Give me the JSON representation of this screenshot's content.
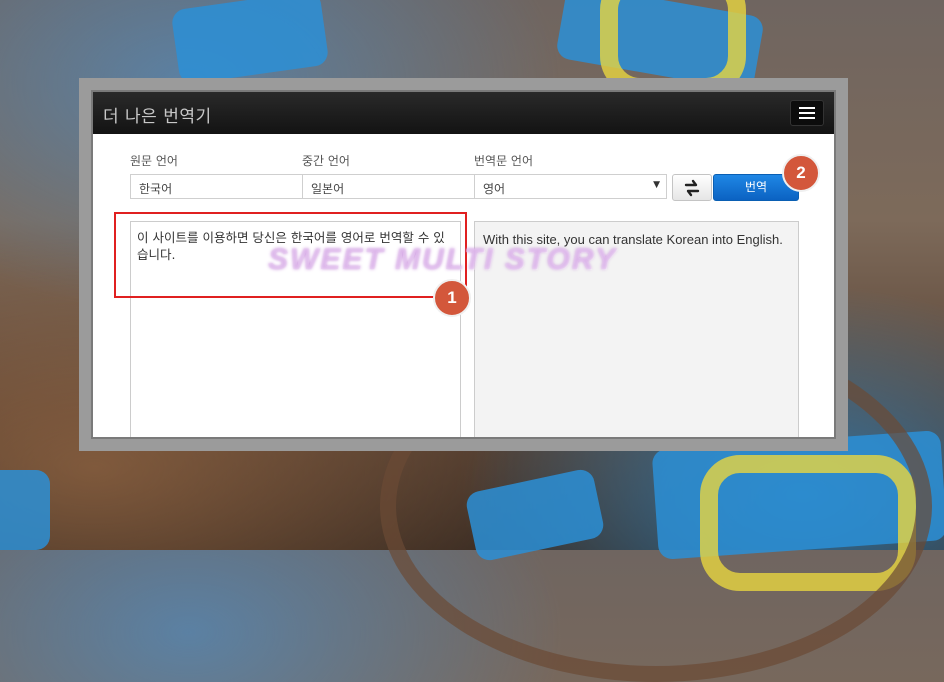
{
  "app": {
    "title": "더 나은 번역기"
  },
  "labels": {
    "source_language": "원문 언어",
    "middle_language": "중간 언어",
    "target_language": "번역문 언어"
  },
  "fields": {
    "source_language_value": "한국어",
    "middle_language_value": "일본어",
    "target_language_value": "영어"
  },
  "buttons": {
    "translate": "번역"
  },
  "icons": {
    "menu": "hamburger-menu-icon",
    "swap": "swap-arrows-icon",
    "dropdown": "chevron-down-icon"
  },
  "source_text": "이 사이트를 이용하면 당신은 한국어를 영어로 번역할 수 있습니다.",
  "output_text": "With this site, you can translate Korean into English.",
  "annotations": {
    "badge_1": "1",
    "badge_2": "2"
  },
  "watermark": "SWEET MULTI STORY",
  "colors": {
    "accent": "#0b62c2",
    "highlight": "#e02020",
    "badge": "#d3573b"
  }
}
